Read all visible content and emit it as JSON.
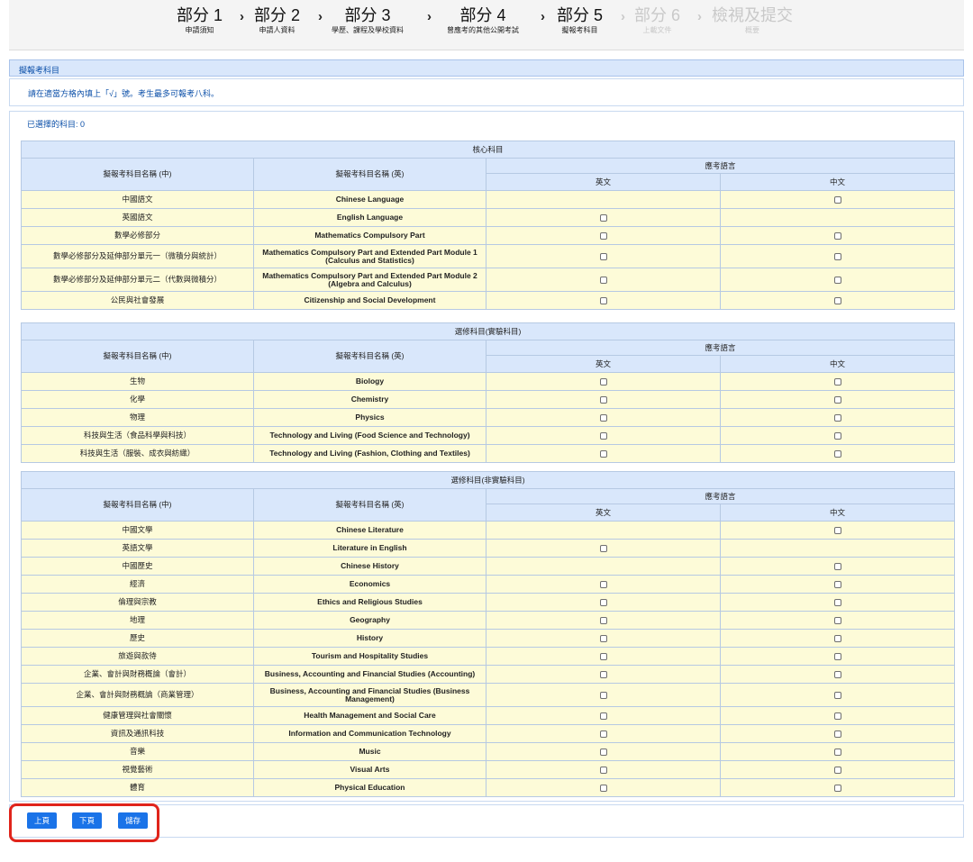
{
  "stepper": {
    "steps": [
      {
        "title": "部分 1",
        "subtitle": "申請須知"
      },
      {
        "title": "部分 2",
        "subtitle": "申請人資料"
      },
      {
        "title": "部分 3",
        "subtitle": "學歷、課程及學校資料"
      },
      {
        "title": "部分 4",
        "subtitle": "曾應考的其他公開考試"
      },
      {
        "title": "部分 5",
        "subtitle": "擬報考科目"
      },
      {
        "title": "部分 6",
        "subtitle": "上載文件"
      },
      {
        "title": "檢視及提交",
        "subtitle": "概要"
      }
    ],
    "arrow": "›"
  },
  "page": {
    "section_title": "擬報考科目",
    "instruction": "請在適當方格內填上「√」號。考生最多可報考八科。",
    "selected_label": "已選擇的科目: ",
    "selected_count": "0"
  },
  "headers": {
    "name_zh": "擬報考科目名稱 (中)",
    "name_en": "擬報考科目名稱 (英)",
    "language": "應考語言",
    "english": "英文",
    "chinese": "中文"
  },
  "tables": [
    {
      "caption": "核心科目",
      "rows": [
        {
          "zh": "中國語文",
          "en": "Chinese Language",
          "eng": false,
          "chi": true
        },
        {
          "zh": "英國語文",
          "en": "English Language",
          "eng": true,
          "chi": false
        },
        {
          "zh": "數學必修部分",
          "en": "Mathematics Compulsory Part",
          "eng": true,
          "chi": true
        },
        {
          "zh": "數學必修部分及延伸部分單元一（微積分與統計）",
          "en": "Mathematics Compulsory Part and Extended Part Module 1 (Calculus and Statistics)",
          "eng": true,
          "chi": true,
          "tall": true
        },
        {
          "zh": "數學必修部分及延伸部分單元二（代數與微積分）",
          "en": "Mathematics Compulsory Part and Extended Part Module 2 (Algebra and Calculus)",
          "eng": true,
          "chi": true,
          "tall": true
        },
        {
          "zh": "公民與社會發展",
          "en": "Citizenship and Social Development",
          "eng": true,
          "chi": true
        }
      ]
    },
    {
      "caption": "選修科目(實驗科目)",
      "rows": [
        {
          "zh": "生物",
          "en": "Biology",
          "eng": true,
          "chi": true
        },
        {
          "zh": "化學",
          "en": "Chemistry",
          "eng": true,
          "chi": true
        },
        {
          "zh": "物理",
          "en": "Physics",
          "eng": true,
          "chi": true
        },
        {
          "zh": "科技與生活（食品科學與科技）",
          "en": "Technology and Living (Food Science and Technology)",
          "eng": true,
          "chi": true
        },
        {
          "zh": "科技與生活（服裝、成衣與紡織）",
          "en": "Technology and Living (Fashion, Clothing and Textiles)",
          "eng": true,
          "chi": true
        }
      ]
    },
    {
      "caption": "選修科目(非實驗科目)",
      "rows": [
        {
          "zh": "中國文學",
          "en": "Chinese Literature",
          "eng": false,
          "chi": true
        },
        {
          "zh": "英語文學",
          "en": "Literature in English",
          "eng": true,
          "chi": false
        },
        {
          "zh": "中國歷史",
          "en": "Chinese History",
          "eng": false,
          "chi": true
        },
        {
          "zh": "經濟",
          "en": "Economics",
          "eng": true,
          "chi": true
        },
        {
          "zh": "倫理與宗教",
          "en": "Ethics and Religious Studies",
          "eng": true,
          "chi": true
        },
        {
          "zh": "地理",
          "en": "Geography",
          "eng": true,
          "chi": true
        },
        {
          "zh": "歷史",
          "en": "History",
          "eng": true,
          "chi": true
        },
        {
          "zh": "旅遊與款待",
          "en": "Tourism and Hospitality Studies",
          "eng": true,
          "chi": true
        },
        {
          "zh": "企業、會計與財務概論（會計）",
          "en": "Business, Accounting and Financial Studies (Accounting)",
          "eng": true,
          "chi": true
        },
        {
          "zh": "企業、會計與財務概論（商業管理）",
          "en": "Business, Accounting and Financial Studies (Business Management)",
          "eng": true,
          "chi": true,
          "tall": true
        },
        {
          "zh": "健康管理與社會關懷",
          "en": "Health Management and Social Care",
          "eng": true,
          "chi": true
        },
        {
          "zh": "資訊及通訊科技",
          "en": "Information and Communication Technology",
          "eng": true,
          "chi": true
        },
        {
          "zh": "音樂",
          "en": "Music",
          "eng": true,
          "chi": true
        },
        {
          "zh": "視覺藝術",
          "en": "Visual Arts",
          "eng": true,
          "chi": true
        },
        {
          "zh": "體育",
          "en": "Physical Education",
          "eng": true,
          "chi": true
        }
      ]
    }
  ],
  "buttons": {
    "prev": "上頁",
    "next": "下頁",
    "save": "儲存"
  }
}
